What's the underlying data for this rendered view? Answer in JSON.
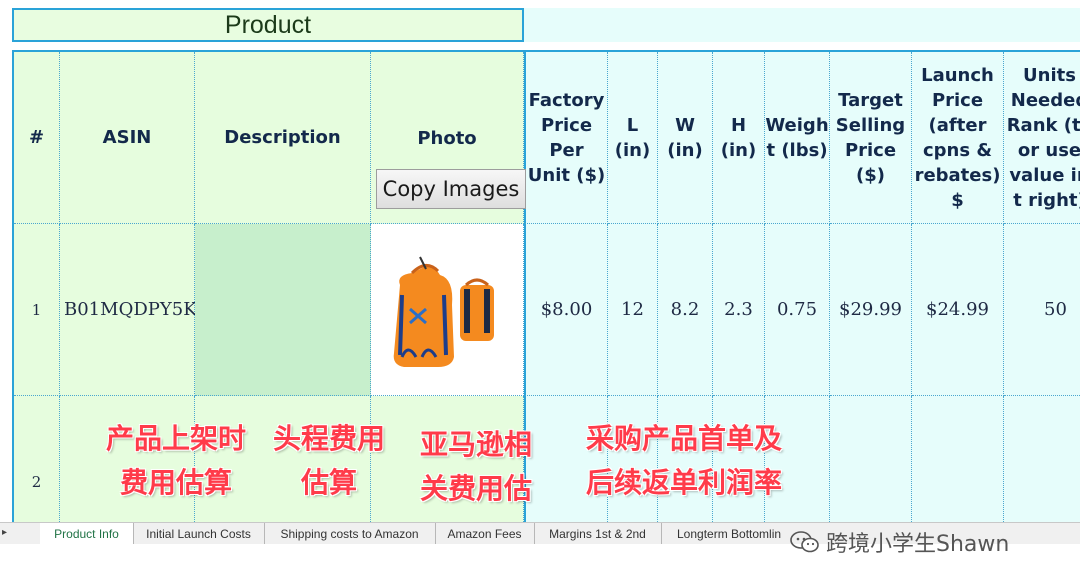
{
  "header": {
    "title": "Product"
  },
  "columns": {
    "num": "#",
    "asin": "ASIN",
    "description": "Description",
    "photo": "Photo",
    "factory_price": "Factory Price Per Unit ($)",
    "l": "L (in)",
    "w": "W (in)",
    "h": "H (in)",
    "weight": "Weigh t (lbs)",
    "target_price": "Target Selling Price ($)",
    "launch_price": "Launch Price (after cpns & rebates) $",
    "units_needed": "Units Needed Rank (ty or use value in t right)"
  },
  "buttons": {
    "copy_images": "Copy Images"
  },
  "rows": [
    {
      "num": "1",
      "asin": "B01MQDPY5K",
      "factory_price": "$8.00",
      "l": "12",
      "w": "8.2",
      "h": "2.3",
      "weight": "0.75",
      "target_price": "$29.99",
      "launch_price": "$24.99",
      "units_needed": "50"
    },
    {
      "num": "2"
    }
  ],
  "overlay": {
    "launch_cost_line1": "产品上架时",
    "launch_cost_line2": "费用估算",
    "shipping_line1": "头程费用",
    "shipping_line2": "估算",
    "amazon_line1": "亚马逊相",
    "amazon_line2": "关费用估",
    "margin_line1": "采购产品首单及",
    "margin_line2": "后续返单利润率"
  },
  "tabs": [
    {
      "label": "Product Info",
      "active": true
    },
    {
      "label": "Initial Launch Costs",
      "active": false
    },
    {
      "label": "Shipping costs to Amazon",
      "active": false
    },
    {
      "label": "Amazon Fees",
      "active": false
    },
    {
      "label": "Margins 1st & 2nd",
      "active": false
    },
    {
      "label": "Longterm Bottomlin",
      "active": false
    }
  ],
  "watermark": {
    "text": "跨境小学生Shawn",
    "icon": "wechat-icon"
  },
  "colors": {
    "accent": "#2aa3d8",
    "overlay_red": "#ff3b4a",
    "green_fill": "#e6fdde",
    "teal_fill": "#e6fdfb"
  }
}
